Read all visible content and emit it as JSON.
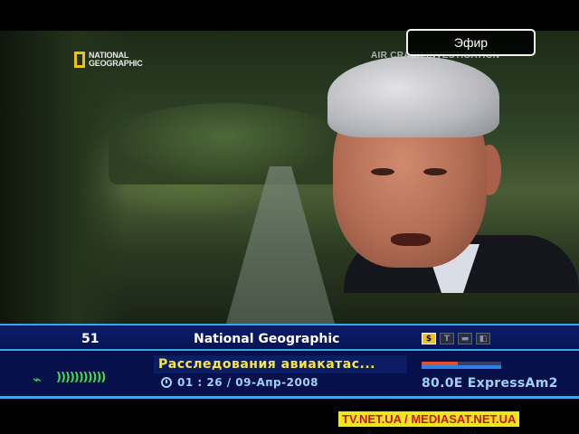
{
  "osd": {
    "live_label": "Эфир"
  },
  "video": {
    "logo_text_line1": "NATIONAL",
    "logo_text_line2": "GEOGRAPHIC",
    "show_title": "AIR CRASH INVESTIGATION"
  },
  "banner": {
    "channel_number": "51",
    "channel_name": "National Geographic",
    "badges": [
      "money-icon",
      "teletext-icon",
      "subtitle-icon",
      "lock-icon"
    ],
    "program_title": "Расследования авиакатас...",
    "time_text": "01 : 26 / 09-Апр-2008",
    "signal_glyph": ")))))))))))",
    "satellite": "80.0E ExpressAm2",
    "signal_quality_fraction": 0.45,
    "signal_strength_fraction": 1.0
  },
  "watermark": "TV.NET.UA / MEDIASAT.NET.UA",
  "colors": {
    "banner_bg": "#07104a",
    "accent_line": "#3da6e6",
    "program_text": "#f5e64a",
    "signal_green": "#3fe04a"
  }
}
